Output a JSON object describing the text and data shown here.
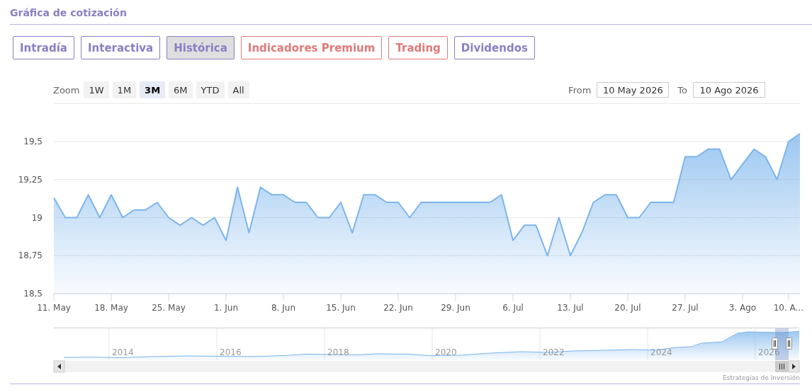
{
  "section_title": "Gráfica de cotización",
  "tabs": [
    {
      "label": "Intradía",
      "kind": "standard",
      "selected": false
    },
    {
      "label": "Interactiva",
      "kind": "standard",
      "selected": false
    },
    {
      "label": "Histórica",
      "kind": "standard",
      "selected": true
    },
    {
      "label": "Indicadores Premium",
      "kind": "premium",
      "selected": false
    },
    {
      "label": "Trading",
      "kind": "premium",
      "selected": false
    },
    {
      "label": "Dividendos",
      "kind": "standard",
      "selected": false
    }
  ],
  "range_selector": {
    "zoom_label": "Zoom",
    "buttons": [
      {
        "label": "1W",
        "selected": false
      },
      {
        "label": "1M",
        "selected": false
      },
      {
        "label": "3M",
        "selected": true
      },
      {
        "label": "6M",
        "selected": false
      },
      {
        "label": "YTD",
        "selected": false
      },
      {
        "label": "All",
        "selected": false
      }
    ],
    "from_label": "From",
    "from_value": "10 May 2026",
    "to_label": "To",
    "to_value": "10 Ago 2026"
  },
  "chart": {
    "chart_data": {
      "type": "area",
      "categories": [
        "11. May",
        null,
        null,
        null,
        null,
        "18. May",
        null,
        null,
        null,
        null,
        "25. May",
        null,
        null,
        null,
        null,
        "1. Jun",
        null,
        null,
        null,
        null,
        "8. Jun",
        null,
        null,
        null,
        null,
        "15. Jun",
        null,
        null,
        null,
        null,
        "22. Jun",
        null,
        null,
        null,
        null,
        "29. Jun",
        null,
        null,
        null,
        null,
        "6. Jul",
        null,
        null,
        null,
        null,
        "13. Jul",
        null,
        null,
        null,
        null,
        "20. Jul",
        null,
        null,
        null,
        null,
        "27. Jul",
        null,
        null,
        null,
        null,
        "3. Ago",
        null,
        null,
        null,
        "10. A...",
        null
      ],
      "series": [
        {
          "color": "#7cb5ec",
          "values": [
            19.13,
            19.0,
            19.0,
            19.15,
            19.0,
            19.15,
            19.0,
            19.05,
            19.05,
            19.1,
            19.0,
            18.95,
            19.0,
            18.95,
            19.0,
            18.85,
            19.2,
            18.9,
            19.2,
            19.15,
            19.15,
            19.1,
            19.1,
            19.0,
            19.0,
            19.1,
            18.9,
            19.15,
            19.15,
            19.1,
            19.1,
            19.0,
            19.1,
            19.1,
            19.1,
            19.1,
            19.1,
            19.1,
            19.1,
            19.15,
            18.85,
            18.95,
            18.95,
            18.75,
            19.0,
            18.75,
            18.9,
            19.1,
            19.15,
            19.15,
            19.0,
            19.0,
            19.1,
            19.1,
            19.1,
            19.4,
            19.4,
            19.45,
            19.45,
            19.25,
            19.35,
            19.45,
            19.4,
            19.25,
            19.5,
            19.55
          ]
        }
      ],
      "ylim": [
        18.5,
        19.75
      ],
      "grid": true,
      "yticks": [
        {
          "value": 18.5,
          "label": "18,5"
        },
        {
          "value": 18.75,
          "label": "18,75"
        },
        {
          "value": 19,
          "label": "19"
        },
        {
          "value": 19.25,
          "label": "19,25"
        },
        {
          "value": 19.5,
          "label": "19,5"
        }
      ]
    }
  },
  "navigator": {
    "year_labels": [
      "2014",
      "2016",
      "2018",
      "2020",
      "2022",
      "2024",
      "2026"
    ]
  },
  "credit": "Estrategias de Inversión"
}
